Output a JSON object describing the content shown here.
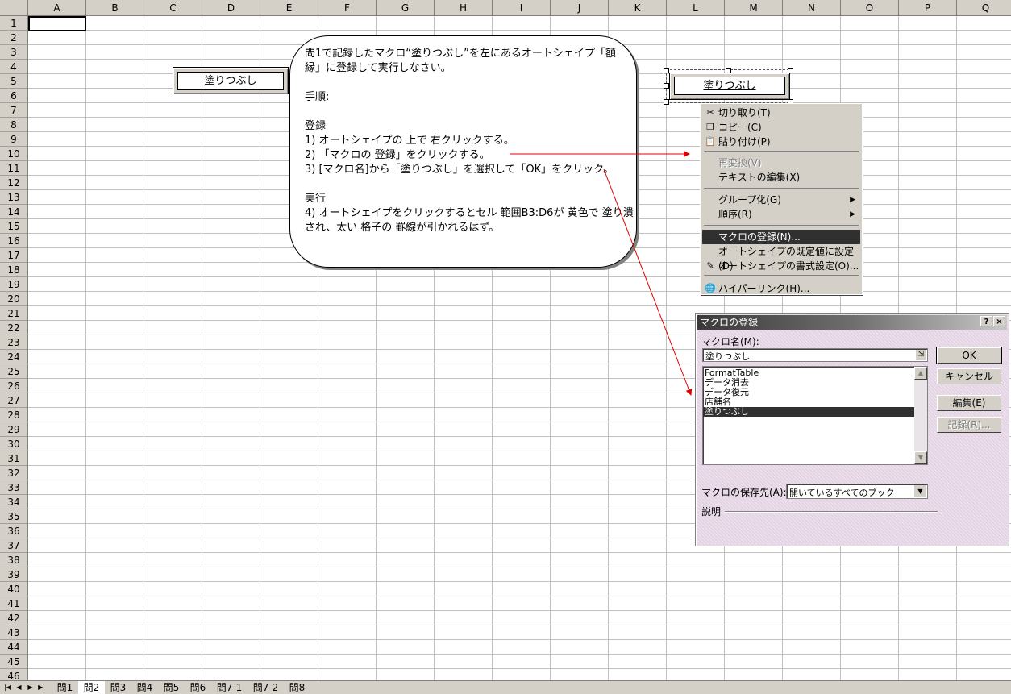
{
  "columns": [
    "A",
    "B",
    "C",
    "D",
    "E",
    "F",
    "G",
    "H",
    "I",
    "J",
    "K",
    "L",
    "M",
    "N",
    "O",
    "P",
    "Q"
  ],
  "rows": [
    "1",
    "2",
    "3",
    "4",
    "5",
    "6",
    "7",
    "8",
    "9",
    "10",
    "11",
    "12",
    "13",
    "14",
    "15",
    "16",
    "17",
    "18",
    "19",
    "20",
    "21",
    "22",
    "23",
    "24",
    "25",
    "26",
    "27",
    "28",
    "29",
    "30",
    "31",
    "32",
    "33",
    "34",
    "35",
    "36",
    "37",
    "38",
    "39",
    "40",
    "41",
    "42",
    "43",
    "44",
    "45",
    "46"
  ],
  "shape_left": {
    "label": "塗りつぶし"
  },
  "shape_right": {
    "label": "塗りつぶし"
  },
  "callout": {
    "lines": [
      "問1で記録したマクロ“塗りつぶし”を左にあるオートシェイプ「額",
      "縁」に登録して実行しなさい。",
      "",
      "手順:",
      "",
      "登録",
      "1) オートシェイプの 上で 右クリックする。",
      "2) 「マクロの 登録」をクリックする。",
      "3) [マクロ名]から「塗りつぶし」を選択して「OK」をクリック。",
      "",
      "実行",
      "4) オートシェイプをクリックするとセル 範囲B3:D6が 黄色で 塗り潰",
      "され、太い 格子の 罫線が引かれるはず。"
    ]
  },
  "context_menu": {
    "items": [
      {
        "label": "切り取り(T)",
        "icon": "scissors-icon",
        "glyph": "✂",
        "disabled": false,
        "highlight": false,
        "submenu": false
      },
      {
        "label": "コピー(C)",
        "icon": "copy-icon",
        "glyph": "❐",
        "disabled": false,
        "highlight": false,
        "submenu": false
      },
      {
        "label": "貼り付け(P)",
        "icon": "paste-icon",
        "glyph": "📋",
        "disabled": false,
        "highlight": false,
        "submenu": false
      },
      {
        "label": "再変換(V)",
        "disabled": true,
        "highlight": false,
        "submenu": false
      },
      {
        "label": "テキストの編集(X)",
        "disabled": false,
        "highlight": false,
        "submenu": false
      },
      {
        "label": "グループ化(G)",
        "disabled": false,
        "highlight": false,
        "submenu": true
      },
      {
        "label": "順序(R)",
        "disabled": false,
        "highlight": false,
        "submenu": true
      },
      {
        "label": "マクロの登録(N)...",
        "disabled": false,
        "highlight": true,
        "submenu": false
      },
      {
        "label": "オートシェイプの既定値に設定(D)",
        "disabled": false,
        "highlight": false,
        "submenu": false
      },
      {
        "label": "オートシェイプの書式設定(O)...",
        "icon": "format-icon",
        "glyph": "✎",
        "disabled": false,
        "highlight": false,
        "submenu": false
      },
      {
        "label": "ハイパーリンク(H)...",
        "icon": "hyperlink-icon",
        "glyph": "🌐",
        "disabled": false,
        "highlight": false,
        "submenu": false
      }
    ]
  },
  "dialog": {
    "title": "マクロの登録",
    "help_button": "?",
    "close_button": "×",
    "macro_name_label": "マクロ名(M):",
    "macro_name_value": "塗りつぶし",
    "macro_list": [
      "FormatTable",
      "データ消去",
      "データ復元",
      "店舗名",
      "塗りつぶし"
    ],
    "selected_macro": "塗りつぶし",
    "buttons": {
      "ok": "OK",
      "cancel": "キャンセル",
      "edit": "編集(E)",
      "record": "記録(R)..."
    },
    "save_in_label": "マクロの保存先(A):",
    "save_in_value": "開いているすべてのブック",
    "description_label": "説明"
  },
  "sheet_tabs": {
    "tabs": [
      "問1",
      "問2",
      "問3",
      "問4",
      "問5",
      "問6",
      "問7-1",
      "問7-2",
      "問8"
    ],
    "active": "問2"
  },
  "colors": {
    "arrow": "#e00000",
    "highlight": "#303030",
    "dialog_bg": "#e4d4e4"
  }
}
